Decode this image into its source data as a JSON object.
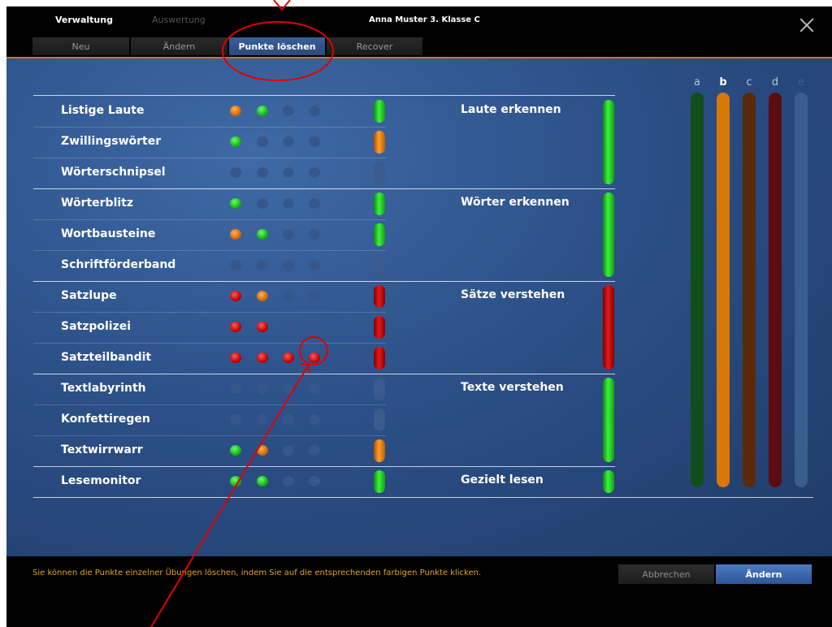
{
  "header": {
    "main_tabs": [
      "Verwaltung",
      "Auswertung"
    ],
    "student": "Anna Muster 3. Klasse C",
    "sub_tabs": [
      "Neu",
      "Ändern",
      "Punkte löschen",
      "Recover"
    ],
    "active_sub_tab": "Punkte löschen"
  },
  "levels": {
    "letters": [
      "a",
      "b",
      "c",
      "d",
      "e"
    ],
    "selected": "b",
    "colors": [
      "#0f4f1c",
      "#d97708",
      "#5a2a0a",
      "#5b0c10",
      "#3a5d8f"
    ]
  },
  "exercises": [
    {
      "name": "Listige Laute",
      "dots": [
        "orange",
        "green",
        "empty",
        "empty"
      ],
      "bar": "green"
    },
    {
      "name": "Zwillingswörter",
      "dots": [
        "green",
        "empty",
        "empty",
        "empty"
      ],
      "bar": "orange"
    },
    {
      "name": "Wörterschnipsel",
      "dots": [
        "empty",
        "empty",
        "empty",
        "empty"
      ],
      "bar": "empty"
    },
    {
      "name": "Wörterblitz",
      "dots": [
        "green",
        "empty",
        "empty",
        "empty"
      ],
      "bar": "green"
    },
    {
      "name": "Wortbausteine",
      "dots": [
        "orange",
        "green",
        "empty",
        "empty"
      ],
      "bar": "green"
    },
    {
      "name": "Schriftförderband",
      "dots": [
        "empty",
        "empty",
        "empty",
        "empty"
      ],
      "bar": "empty"
    },
    {
      "name": "Satzlupe",
      "dots": [
        "red",
        "orange",
        "empty",
        "empty"
      ],
      "bar": "red"
    },
    {
      "name": "Satzpolizei",
      "dots": [
        "red",
        "red",
        "empty",
        "empty"
      ],
      "bar": "red"
    },
    {
      "name": "Satzteilbandit",
      "dots": [
        "red",
        "red",
        "red",
        "red"
      ],
      "bar": "red"
    },
    {
      "name": "Textlabyrinth",
      "dots": [
        "empty",
        "empty",
        "empty",
        "empty"
      ],
      "bar": "empty"
    },
    {
      "name": "Konfettiregen",
      "dots": [
        "empty",
        "empty",
        "empty",
        "empty"
      ],
      "bar": "empty"
    },
    {
      "name": "Textwirrwarr",
      "dots": [
        "green",
        "orange",
        "empty",
        "empty"
      ],
      "bar": "orange"
    },
    {
      "name": "Lesemonitor",
      "dots": [
        "green",
        "green",
        "empty",
        "empty"
      ],
      "bar": "green"
    }
  ],
  "categories": [
    {
      "name": "Laute erkennen",
      "color": "green"
    },
    {
      "name": "Wörter erkennen",
      "color": "green"
    },
    {
      "name": "Sätze verstehen",
      "color": "red"
    },
    {
      "name": "Texte verstehen",
      "color": "green"
    },
    {
      "name": "Gezielt lesen",
      "color": "green"
    }
  ],
  "footer": {
    "hint": "Sie können die Punkte einzelner Übungen löschen, indem Sie auf die entsprechenden farbigen Punkte klicken.",
    "cancel_label": "Abbrechen",
    "apply_label": "Ändern"
  }
}
